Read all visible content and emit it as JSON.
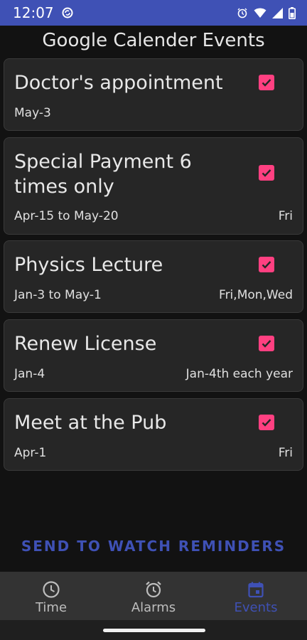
{
  "status_bar": {
    "time": "12:07",
    "icons": [
      "sync-icon",
      "alarm-icon",
      "wifi-icon",
      "signal-icon",
      "battery-icon"
    ],
    "color": "#3f51b5"
  },
  "page": {
    "title": "Google Calender Events"
  },
  "events": [
    {
      "title": "Doctor's appointment",
      "date": "May-3",
      "repeat": "",
      "checked": true
    },
    {
      "title": "Special Payment 6 times only",
      "date": "Apr-15 to May-20",
      "repeat": "Fri",
      "checked": true
    },
    {
      "title": "Physics Lecture",
      "date": "Jan-3 to May-1",
      "repeat": "Fri,Mon,Wed",
      "checked": true
    },
    {
      "title": "Renew License",
      "date": "Jan-4",
      "repeat": "Jan-4th each year",
      "checked": true
    },
    {
      "title": "Meet at the Pub",
      "date": "Apr-1",
      "repeat": "Fri",
      "checked": true
    }
  ],
  "actions": {
    "send_label": "SEND TO WATCH REMINDERS"
  },
  "bottom_nav": {
    "items": [
      {
        "label": "Time",
        "icon": "clock-icon",
        "active": false
      },
      {
        "label": "Alarms",
        "icon": "alarm-clock-icon",
        "active": false
      },
      {
        "label": "Events",
        "icon": "calendar-icon",
        "active": true
      }
    ]
  },
  "colors": {
    "accent": "#3f51b5",
    "checkbox": "#ff4081",
    "card": "#262626",
    "background": "#121212"
  }
}
